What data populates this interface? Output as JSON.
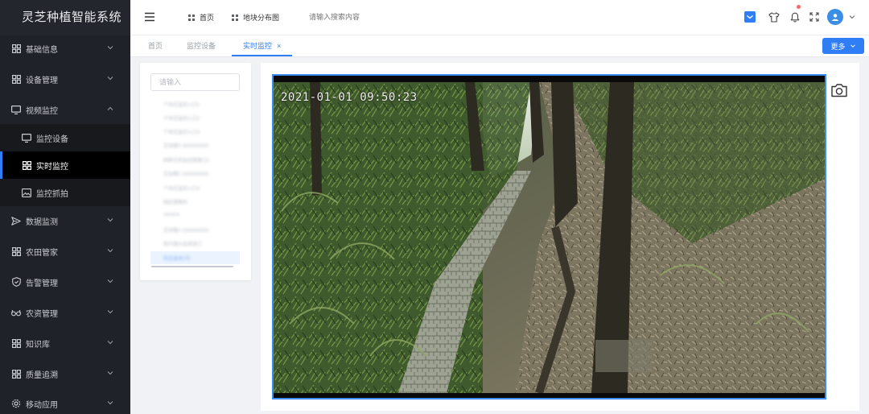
{
  "app": {
    "title": "灵芝种植智能系统"
  },
  "sidebar": {
    "items": [
      {
        "label": "基础信息",
        "icon": "grid-icon"
      },
      {
        "label": "设备管理",
        "icon": "grid-icon"
      },
      {
        "label": "视频监控",
        "icon": "monitor-icon",
        "expanded": true,
        "children": [
          {
            "label": "监控设备",
            "icon": "monitor-icon"
          },
          {
            "label": "实时监控",
            "icon": "grid-icon",
            "active": true
          },
          {
            "label": "监控抓拍",
            "icon": "image-icon"
          }
        ]
      },
      {
        "label": "数据监测",
        "icon": "send-icon"
      },
      {
        "label": "农田管家",
        "icon": "grid-icon"
      },
      {
        "label": "告警管理",
        "icon": "shield-icon"
      },
      {
        "label": "农资管理",
        "icon": "glasses-icon"
      },
      {
        "label": "知识库",
        "icon": "grid-icon"
      },
      {
        "label": "质量追溯",
        "icon": "grid-icon"
      },
      {
        "label": "移动应用",
        "icon": "gear-icon"
      }
    ]
  },
  "header": {
    "breadcrumbs": [
      {
        "label": "首页"
      },
      {
        "label": "地块分布图"
      }
    ],
    "search_placeholder": "请输入搜索内容"
  },
  "tabs": {
    "items": [
      {
        "label": "首页"
      },
      {
        "label": "监控设备"
      },
      {
        "label": "实时监控",
        "active": true,
        "close": "×"
      }
    ],
    "more_label": "更多"
  },
  "device_list": {
    "search_placeholder": "请输入",
    "items": [
      "个体芝监控入口1",
      "个体芝监控入口2",
      "个体芝监控入口3",
      "芝加看5 1500000000",
      "种群芝和监控摄像口1",
      "芝加看5 1500000000",
      "个体芝监控入口3",
      "园区摄像机",
      "camera",
      "芝加看5 1500000000",
      "鱼片菌头监视室口",
      "西芝森林2号"
    ],
    "selected_index": 11
  },
  "video": {
    "timestamp": "2021-01-01 09:50:23"
  },
  "colors": {
    "sidebar_bg": "#1f2228",
    "accent": "#2f7df7",
    "active_item_bg": "#000000"
  }
}
